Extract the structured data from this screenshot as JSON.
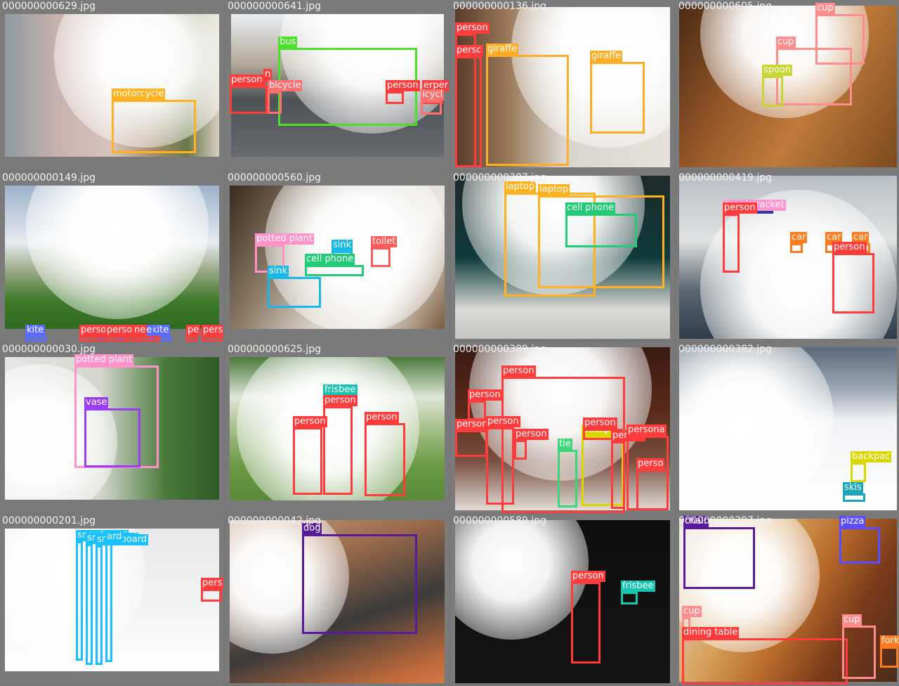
{
  "colors": {
    "person": "#ff3b3b",
    "bicycle": "#ff6f6f",
    "car": "#ff7a1a",
    "motorcycle": "#ffb21d",
    "bus": "#4ce02a",
    "giraffe": "#ffad26",
    "cup": "#ff8d8d",
    "spoon": "#c7d631",
    "kite": "#5a6cff",
    "potted plant": "#ff92c9",
    "sink": "#18b8e8",
    "cell phone": "#22cc77",
    "toilet": "#ff5a5a",
    "laptop": "#ffb21d",
    "sports ball": "#2b3c9e",
    "tennis racket": "#ff94d0",
    "vase": "#9b3df0",
    "frisbee": "#17c4b0",
    "tie": "#3bd67a",
    "backpack": "#d8d800",
    "skis": "#1aa6b8",
    "snowboard": "#18c2ff",
    "dog": "#5a1a9e",
    "pizza": "#5a4dff",
    "chair": "#5a1a9e",
    "dining table": "#ff3b3b",
    "fork": "#ff7a1a"
  },
  "cells": [
    {
      "file": "000000000629.jpg",
      "bg": "linear-gradient(90deg,#8f9aa3 0%,#c9b2ad 25%,#d7c3bd 50%,#a58c6e 70%,#6a7a4a 85%,#d9cdc2 100%)",
      "glow": "bright",
      "labels": [
        {
          "text": "motorcycle",
          "cls": "motorcycle"
        }
      ]
    },
    {
      "file": "000000000641.jpg",
      "bg": "linear-gradient(180deg,#e8eef3 0%,#b4a899 35%,#4d5257 60%,#676b70 100%)",
      "glow": "bright",
      "labels": [
        {
          "text": "bus",
          "cls": "bus"
        },
        {
          "text": "person",
          "cls": "person"
        },
        {
          "text": "n",
          "cls": "person"
        },
        {
          "text": "bicycle",
          "cls": "bicycle"
        },
        {
          "text": "person",
          "cls": "person"
        },
        {
          "text": "erper",
          "cls": "person"
        },
        {
          "text": "icycl",
          "cls": "bicycle"
        }
      ]
    },
    {
      "file": "000000000136.jpg",
      "bg": "linear-gradient(90deg,#5a3a2a 0%,#9a7a5a 25%,#d9d4cc 50%,#e6e2da 100%)",
      "glow": "bright",
      "labels": [
        {
          "text": "person",
          "cls": "person"
        },
        {
          "text": "persc",
          "cls": "person"
        },
        {
          "text": "giraffe",
          "cls": "giraffe"
        },
        {
          "text": "giraffe",
          "cls": "giraffe"
        }
      ]
    },
    {
      "file": "000000000605.jpg",
      "bg": "linear-gradient(120deg,#4a2a14 0%,#9a5a2a 35%,#c07a3a 60%,#7a4a1e 100%)",
      "glow": "bright",
      "labels": [
        {
          "text": "cup",
          "cls": "cup"
        },
        {
          "text": "cup",
          "cls": "cup"
        },
        {
          "text": "spoon",
          "cls": "spoon"
        }
      ]
    },
    {
      "file": "000000000149.jpg",
      "bg": "linear-gradient(180deg,#9db3cc 0%,#e6ebef 40%,#8fa27a 62%,#3e7a2a 80%,#2f6a22 100%)",
      "glow": "bright",
      "labels": [
        {
          "text": "kite",
          "cls": "kite"
        },
        {
          "text": "kite",
          "cls": "kite"
        },
        {
          "text": "kite",
          "cls": "kite"
        },
        {
          "text": "kite",
          "cls": "kite"
        },
        {
          "text": "kite",
          "cls": "kite"
        },
        {
          "text": "kite",
          "cls": "kite"
        },
        {
          "text": "person",
          "cls": "person"
        },
        {
          "text": "person",
          "cls": "person"
        },
        {
          "text": "ne",
          "cls": "person"
        },
        {
          "text": "pe",
          "cls": "person"
        },
        {
          "text": "pers",
          "cls": "person"
        }
      ]
    },
    {
      "file": "000000000560.jpg",
      "bg": "linear-gradient(120deg,#3a2a1e 0%,#8a7a66 30%,#d8d0c6 55%,#eae6e0 75%,#7a5a3a 100%)",
      "glow": "bright",
      "labels": [
        {
          "text": "potted plant",
          "cls": "potted plant"
        },
        {
          "text": "sink",
          "cls": "sink"
        },
        {
          "text": "toilet",
          "cls": "toilet"
        },
        {
          "text": "sink",
          "cls": "sink"
        },
        {
          "text": "cell phone",
          "cls": "cell phone"
        }
      ]
    },
    {
      "file": "000000000387.jpg",
      "bg": "linear-gradient(180deg,#1e2a2a 0%,#0e3a3a 50%,#d9dad6 82%,#c4c6c2 100%)",
      "glow": "bright",
      "labels": [
        {
          "text": "laptop",
          "cls": "laptop"
        },
        {
          "text": "laptop",
          "cls": "laptop"
        },
        {
          "text": "cell phone",
          "cls": "cell phone"
        }
      ]
    },
    {
      "file": "000000000419.jpg",
      "bg": "linear-gradient(180deg,#b9c0c6 0%,#e0e2e2 40%,#5a6670 70%,#2e3e4a 100%)",
      "glow": "bright",
      "labels": [
        {
          "text": "sports ball",
          "cls": "sports ball"
        },
        {
          "text": "tennis racket",
          "cls": "tennis racket"
        },
        {
          "text": "person",
          "cls": "person"
        },
        {
          "text": "car",
          "cls": "car"
        },
        {
          "text": "car",
          "cls": "car"
        },
        {
          "text": "car",
          "cls": "car"
        },
        {
          "text": "person",
          "cls": "person"
        }
      ]
    },
    {
      "file": "000000000030.jpg",
      "bg": "linear-gradient(90deg,#e6e6e6 0%,#d2d6cc 45%,#4a7a3a 75%,#2e5a26 100%)",
      "glow": "bright",
      "labels": [
        {
          "text": "potted plant",
          "cls": "potted plant"
        },
        {
          "text": "vase",
          "cls": "vase"
        }
      ]
    },
    {
      "file": "000000000625.jpg",
      "bg": "linear-gradient(180deg,#4a7a3a 0%,#dfe6d8 28%,#a6c08a 50%,#6a9a44 75%,#5a8a3a 100%)",
      "glow": "bright",
      "labels": [
        {
          "text": "frisbee",
          "cls": "frisbee"
        },
        {
          "text": "person",
          "cls": "person"
        },
        {
          "text": "person",
          "cls": "person"
        },
        {
          "text": "person",
          "cls": "person"
        }
      ]
    },
    {
      "file": "000000000389.jpg",
      "bg": "linear-gradient(180deg,#3a1a12 0%,#5a2a1a 40%,#7a5040 70%,#e0dcd6 100%)",
      "glow": "bright",
      "labels": [
        {
          "text": "person",
          "cls": "person"
        },
        {
          "text": "person",
          "cls": "person"
        },
        {
          "text": "person",
          "cls": "person"
        },
        {
          "text": "person",
          "cls": "person"
        },
        {
          "text": "person",
          "cls": "person"
        },
        {
          "text": "tie",
          "cls": "tie"
        },
        {
          "text": "backpa",
          "cls": "backpack"
        },
        {
          "text": "person",
          "cls": "person"
        },
        {
          "text": "person",
          "cls": "person"
        },
        {
          "text": "persona",
          "cls": "person"
        },
        {
          "text": "perso",
          "cls": "person"
        }
      ]
    },
    {
      "file": "000000000382.jpg",
      "bg": "linear-gradient(180deg,#5a6a78 0%,#9aa6b2 25%,#f0f2f5 45%,#ffffff 100%)",
      "glow": "bright",
      "labels": [
        {
          "text": "backpac",
          "cls": "backpack"
        },
        {
          "text": "skis",
          "cls": "skis"
        }
      ]
    },
    {
      "file": "000000000201.jpg",
      "bg": "linear-gradient(180deg,#e6e8ea 0%,#f3f4f5 60%,#ffffff 100%)",
      "glow": "bright",
      "labels": [
        {
          "text": "snowboard",
          "cls": "snowboard"
        },
        {
          "text": "snowboard",
          "cls": "snowboard"
        },
        {
          "text": "snowboard",
          "cls": "snowboard"
        },
        {
          "text": "ard",
          "cls": "snowboard"
        },
        {
          "text": "pers",
          "cls": "person"
        }
      ]
    },
    {
      "file": "000000000042.jpg",
      "bg": "linear-gradient(160deg,#c4a080 0%,#9a6a4a 30%,#3a3a3a 60%,#c06a3a 90%,#d07a4a 100%)",
      "glow": "bright",
      "labels": [
        {
          "text": "dog",
          "cls": "dog"
        }
      ]
    },
    {
      "file": "000000000589.jpg",
      "bg": "linear-gradient(180deg,#0e0e0e 0%,#141414 100%)",
      "glow": "bright",
      "labels": [
        {
          "text": "person",
          "cls": "person"
        },
        {
          "text": "frisbee",
          "cls": "frisbee"
        }
      ]
    },
    {
      "file": "000000000397.jpg",
      "bg": "linear-gradient(120deg,#e8e4de 0%,#d6a05a 35%,#b86a2a 55%,#7a3a1a 75%,#4a2a1a 100%)",
      "glow": "bright",
      "labels": [
        {
          "text": "chair",
          "cls": "chair"
        },
        {
          "text": "pizza",
          "cls": "pizza"
        },
        {
          "text": "cup",
          "cls": "cup"
        },
        {
          "text": "dining table",
          "cls": "dining table"
        },
        {
          "text": "cup",
          "cls": "cup"
        },
        {
          "text": "fork",
          "cls": "fork"
        }
      ]
    }
  ]
}
